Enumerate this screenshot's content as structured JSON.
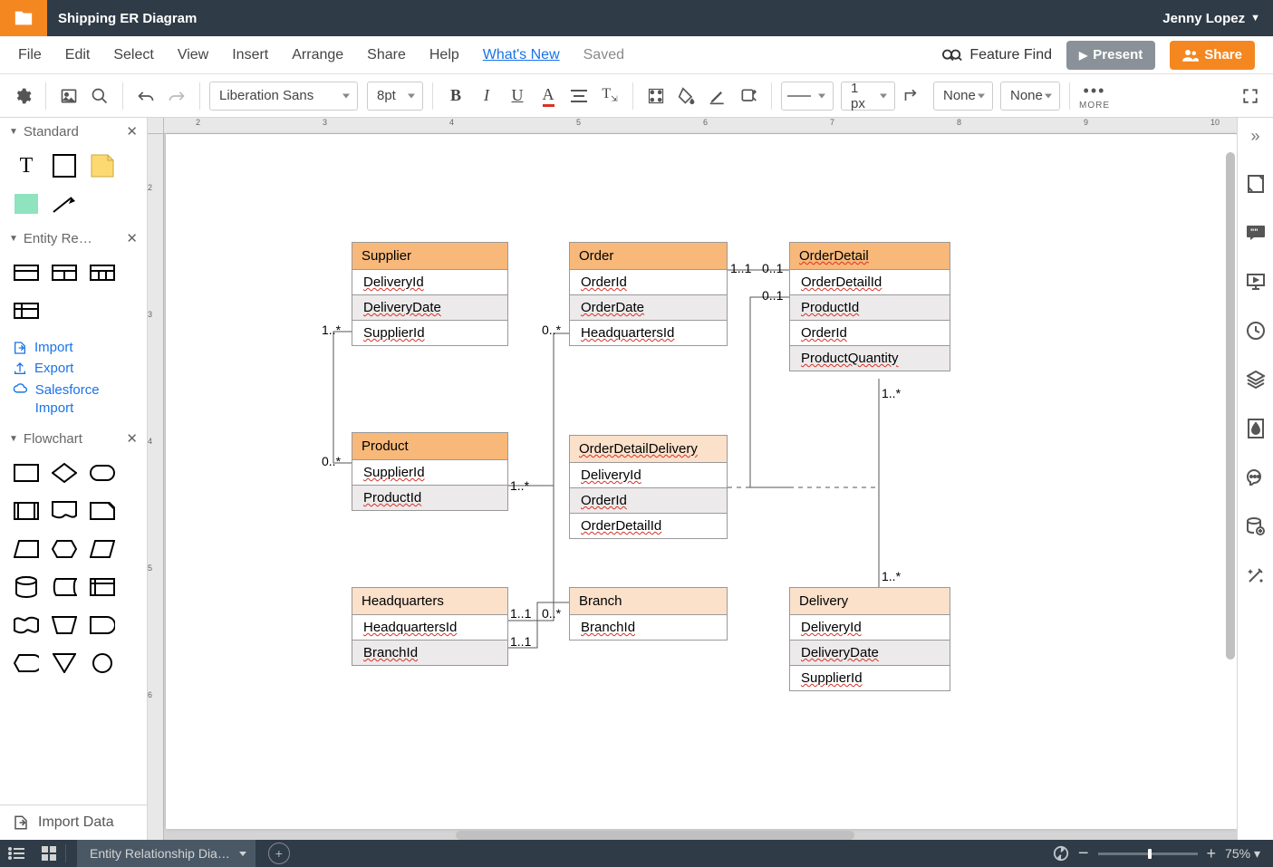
{
  "titlebar": {
    "title": "Shipping ER Diagram",
    "user": "Jenny Lopez"
  },
  "menu": {
    "items": [
      "File",
      "Edit",
      "Select",
      "View",
      "Insert",
      "Arrange",
      "Share",
      "Help"
    ],
    "whatsnew": "What's New",
    "saved": "Saved",
    "featurefind": "Feature Find",
    "present": "Present",
    "share": "Share"
  },
  "toolbar": {
    "font": "Liberation Sans",
    "fontsize": "8pt",
    "linewidth": "1 px",
    "line_arrow_start": "None",
    "line_arrow_end": "None",
    "more": "MORE"
  },
  "leftpanel": {
    "sections": {
      "standard": "Standard",
      "entity": "Entity Re…",
      "flowchart": "Flowchart"
    },
    "links": {
      "import": "Import",
      "export": "Export",
      "salesforce": "Salesforce Import"
    },
    "import_data": "Import Data"
  },
  "footer": {
    "page_tab": "Entity Relationship Dia…",
    "zoom": "75%"
  },
  "entities": {
    "supplier": {
      "name": "Supplier",
      "fields": [
        "DeliveryId",
        "DeliveryDate",
        "SupplierId"
      ]
    },
    "product": {
      "name": "Product",
      "fields": [
        "SupplierId",
        "ProductId"
      ]
    },
    "headquarters": {
      "name": "Headquarters",
      "fields": [
        "HeadquartersId",
        "BranchId"
      ]
    },
    "order": {
      "name": "Order",
      "fields": [
        "OrderId",
        "OrderDate",
        "HeadquartersId"
      ]
    },
    "odd": {
      "name": "OrderDetailDelivery",
      "fields": [
        "DeliveryId",
        "OrderId",
        "OrderDetailId"
      ]
    },
    "branch": {
      "name": "Branch",
      "fields": [
        "BranchId"
      ]
    },
    "orderdetail": {
      "name": "OrderDetail",
      "fields": [
        "OrderDetailId",
        "ProductId",
        "OrderId",
        "ProductQuantity"
      ]
    },
    "delivery": {
      "name": "Delivery",
      "fields": [
        "DeliveryId",
        "DeliveryDate",
        "SupplierId"
      ]
    }
  },
  "cardinalities": {
    "c1": "1..*",
    "c2": "0..*",
    "c3": "1..*",
    "c4": "0..*",
    "c5": "1..1",
    "c6": "1..1",
    "c7": "0..*",
    "c8": "1..1",
    "c9": "0..1",
    "c10": "0..1",
    "c11": "1..*",
    "c12": "1..*"
  },
  "ruler_h": [
    "2",
    "3",
    "4",
    "5",
    "6",
    "7",
    "8",
    "9",
    "10"
  ],
  "ruler_v": [
    "2",
    "3",
    "4",
    "5",
    "6"
  ]
}
